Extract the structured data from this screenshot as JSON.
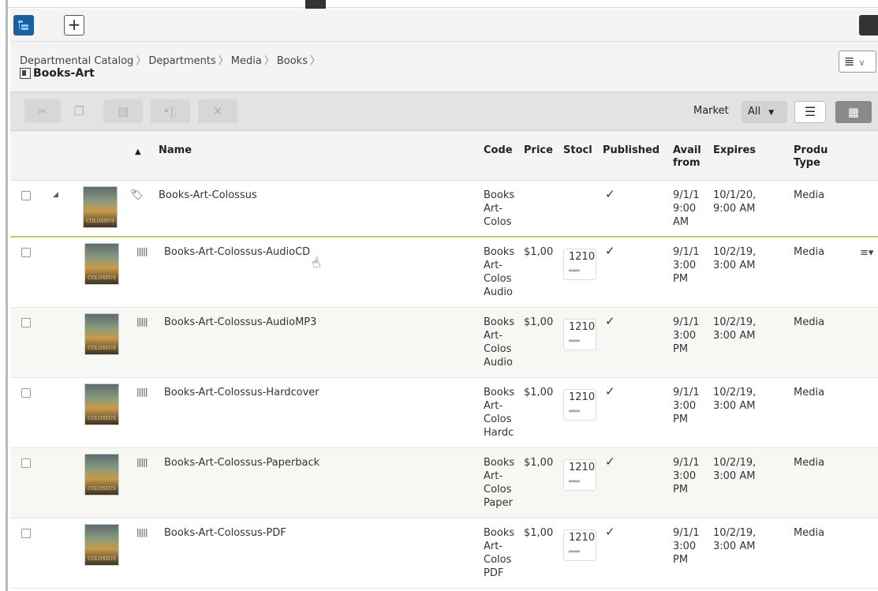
{
  "app": {
    "breadcrumb": [
      "Departmental Catalog",
      "Departments",
      "Media",
      "Books"
    ],
    "title": "Books-Art"
  },
  "toolbar": {
    "market_label": "Market",
    "market_value": "All"
  },
  "table": {
    "headers": {
      "name": "Name",
      "code": "Code",
      "price": "Price",
      "stock": "Stock",
      "published": "Published",
      "avail_from": "Avail from",
      "expires": "Expires",
      "product_type": "Product Type"
    },
    "header_display": {
      "stock": "Stocl",
      "avail_line1": "Avail",
      "avail_line2": "from",
      "ptype_line1": "Produ",
      "ptype_line2": "Type"
    },
    "rows": [
      {
        "name": "Books-Art-Colossus",
        "code": [
          "Books",
          "Art-",
          "Colos"
        ],
        "price": "",
        "stock": "",
        "published": "✓",
        "avail": [
          "9/1/1",
          "9:00",
          "AM"
        ],
        "expires": [
          "10/1/20,",
          "9:00 AM"
        ],
        "type": "Media"
      },
      {
        "name": "Books-Art-Colossus-AudioCD",
        "code": [
          "Books",
          "Art-",
          "Colos",
          "Audio"
        ],
        "price": "$1,00",
        "stock": "1210",
        "published": "✓",
        "avail": [
          "9/1/1",
          "3:00",
          "PM"
        ],
        "expires": [
          "10/2/19,",
          "3:00 AM"
        ],
        "type": "Media"
      },
      {
        "name": "Books-Art-Colossus-AudioMP3",
        "code": [
          "Books",
          "Art-",
          "Colos",
          "Audio"
        ],
        "price": "$1,00",
        "stock": "1210",
        "published": "✓",
        "avail": [
          "9/1/1",
          "3:00",
          "PM"
        ],
        "expires": [
          "10/2/19,",
          "3:00 AM"
        ],
        "type": "Media"
      },
      {
        "name": "Books-Art-Colossus-Hardcover",
        "code": [
          "Books",
          "Art-",
          "Colos",
          "Hardc"
        ],
        "price": "$1,00",
        "stock": "1210",
        "published": "✓",
        "avail": [
          "9/1/1",
          "3:00",
          "PM"
        ],
        "expires": [
          "10/2/19,",
          "3:00 AM"
        ],
        "type": "Media"
      },
      {
        "name": "Books-Art-Colossus-Paperback",
        "code": [
          "Books",
          "Art-",
          "Colos",
          "Paper"
        ],
        "price": "$1,00",
        "stock": "1210",
        "published": "✓",
        "avail": [
          "9/1/1",
          "3:00",
          "PM"
        ],
        "expires": [
          "10/2/19,",
          "3:00 AM"
        ],
        "type": "Media"
      },
      {
        "name": "Books-Art-Colossus-PDF",
        "code": [
          "Books",
          "Art-",
          "Colos",
          "PDF"
        ],
        "price": "$1,00",
        "stock": "1210",
        "published": "✓",
        "avail": [
          "9/1/1",
          "3:00",
          "PM"
        ],
        "expires": [
          "10/2/19,",
          "3:00 AM"
        ],
        "type": "Media"
      }
    ]
  },
  "colors": {
    "accent_blue": "#1d5f9e",
    "selected_row_border": "#c6cf5d"
  }
}
